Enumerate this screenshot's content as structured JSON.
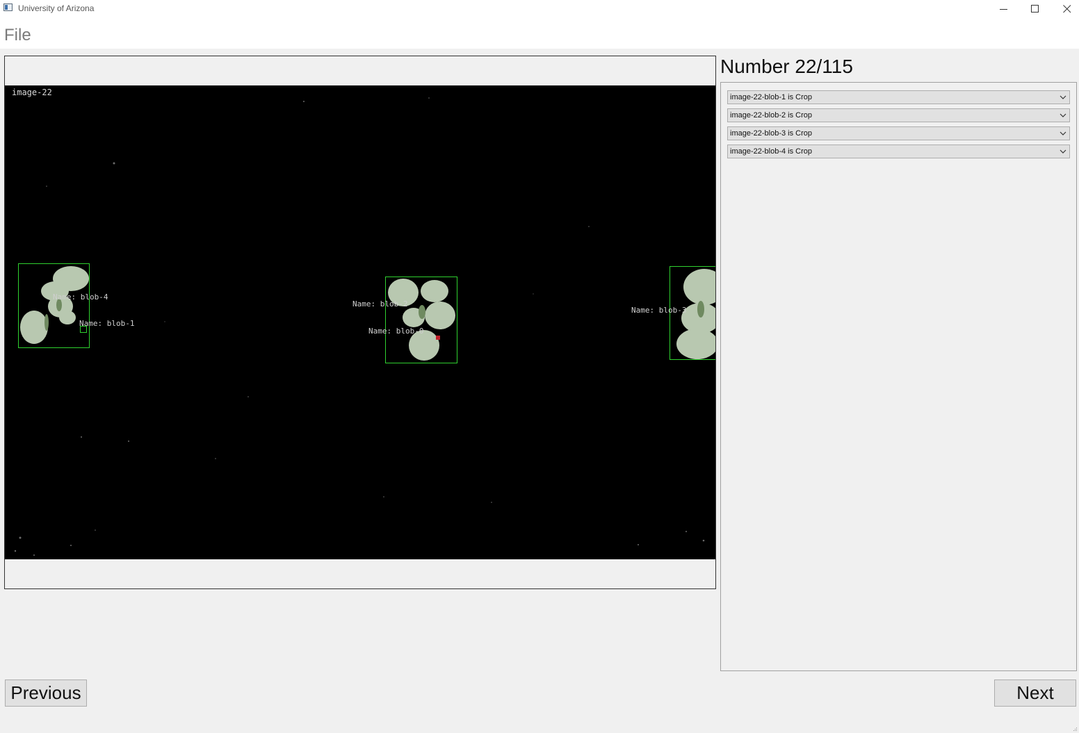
{
  "window": {
    "title": "University of Arizona"
  },
  "menu": {
    "file_label": "File"
  },
  "image": {
    "caption": "image-22",
    "blobs": [
      {
        "label": "Name: blob-4"
      },
      {
        "label": "Name: blob-1"
      },
      {
        "label": "Name: blob-2"
      },
      {
        "label": "Name: blob-0"
      },
      {
        "label": "Name: blob-3"
      }
    ]
  },
  "counter": "Number 22/115",
  "classifications": [
    {
      "value": "image-22-blob-1 is Crop"
    },
    {
      "value": "image-22-blob-2 is Crop"
    },
    {
      "value": "image-22-blob-3 is Crop"
    },
    {
      "value": "image-22-blob-4 is Crop"
    }
  ],
  "buttons": {
    "previous": "Previous",
    "next": "Next"
  },
  "colors": {
    "bbox": "#2fd12f",
    "canvas": "#000000",
    "leaf": "#b8c8b0"
  },
  "icons": [
    "app-icon",
    "minimize-icon",
    "maximize-icon",
    "close-icon",
    "chevron-down-icon"
  ]
}
